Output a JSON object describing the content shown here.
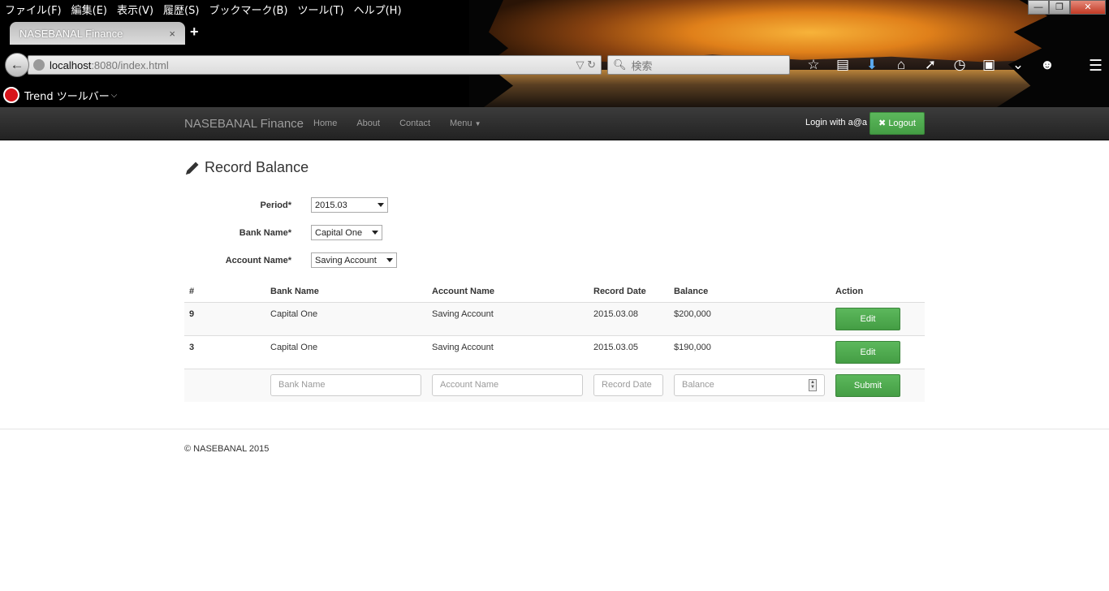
{
  "browser": {
    "menu": [
      "ファイル(F)",
      "編集(E)",
      "表示(V)",
      "履歴(S)",
      "ブックマーク(B)",
      "ツール(T)",
      "ヘルプ(H)"
    ],
    "tab_title": "NASEBANAL Finance",
    "tab_close": "×",
    "new_tab": "+",
    "url_host": "localhost",
    "url_rest": ":8080/index.html",
    "search_placeholder": "検索",
    "toolbar_name": "Trend ツールバー",
    "toolbar_caret": "⌵",
    "window_controls": [
      "—",
      "❐",
      "✕"
    ]
  },
  "navbar": {
    "brand": "NASEBANAL Finance",
    "links": [
      "Home",
      "About",
      "Contact",
      "Menu"
    ],
    "login_text": "Login with a@a",
    "logout_label": "Logout"
  },
  "page": {
    "title": "Record Balance"
  },
  "form": {
    "period_label": "Period*",
    "period_value": "2015.03",
    "bank_label": "Bank Name*",
    "bank_value": "Capital One",
    "account_label": "Account Name*",
    "account_value": "Saving Account"
  },
  "table": {
    "headers": [
      "#",
      "Bank Name",
      "Account Name",
      "Record Date",
      "Balance",
      "Action"
    ],
    "rows": [
      {
        "id": "9",
        "bank": "Capital One",
        "account": "Saving Account",
        "date": "2015.03.08",
        "balance": "$200,000",
        "action": "Edit"
      },
      {
        "id": "3",
        "bank": "Capital One",
        "account": "Saving Account",
        "date": "2015.03.05",
        "balance": "$190,000",
        "action": "Edit"
      }
    ],
    "new_row": {
      "bank_placeholder": "Bank Name",
      "account_placeholder": "Account Name",
      "date_placeholder": "Record Date",
      "balance_placeholder": "Balance",
      "submit_label": "Submit"
    }
  },
  "footer": {
    "text": "© NASEBANAL 2015"
  },
  "colors": {
    "brand_green": "#5cb85c",
    "navbar_dark": "#222222"
  }
}
